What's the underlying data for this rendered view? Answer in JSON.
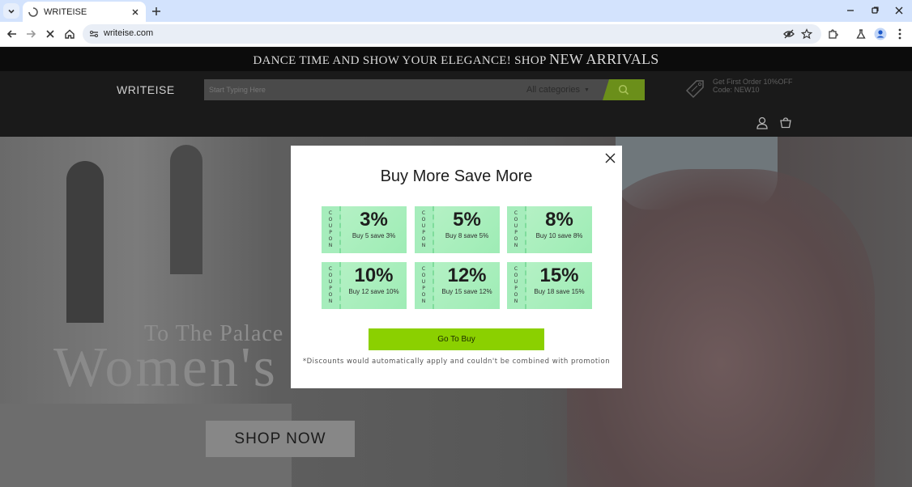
{
  "browser": {
    "tab": {
      "title": "WRITEISE"
    },
    "url": "writeise.com"
  },
  "promo_bar": {
    "text_small": "DANCE TIME AND SHOW YOUR ELEGANCE!  SHOP",
    "text_big": "NEW ARRIVALS"
  },
  "header": {
    "logo": "WRITEISE",
    "search": {
      "placeholder": "Start Typing Here"
    },
    "category": "All categories",
    "first_order": {
      "line1": "Get First Order 10%OFF",
      "line2": "Code:  NEW10"
    }
  },
  "hero": {
    "subtitle": "To The Palace O",
    "title": "Women's",
    "cta": "SHOP NOW"
  },
  "modal": {
    "title": "Buy More Save More",
    "coupon_label": [
      "C",
      "O",
      "U",
      "P",
      "O",
      "N"
    ],
    "coupons": [
      {
        "pct": "3%",
        "desc": "Buy 5 save 3%"
      },
      {
        "pct": "5%",
        "desc": "Buy 8 save 5%"
      },
      {
        "pct": "8%",
        "desc": "Buy 10 save 8%"
      },
      {
        "pct": "10%",
        "desc": "Buy 12 save 10%"
      },
      {
        "pct": "12%",
        "desc": "Buy 15 save 12%"
      },
      {
        "pct": "15%",
        "desc": "Buy 18 save 15%"
      }
    ],
    "button": "Go To Buy",
    "disclaimer": "*Discounts would automatically apply and couldn't be combined with promotion"
  },
  "colors": {
    "accent_green": "#8bd000",
    "coupon_green": "#b8f2c7",
    "search_button": "#6b8f1a"
  }
}
